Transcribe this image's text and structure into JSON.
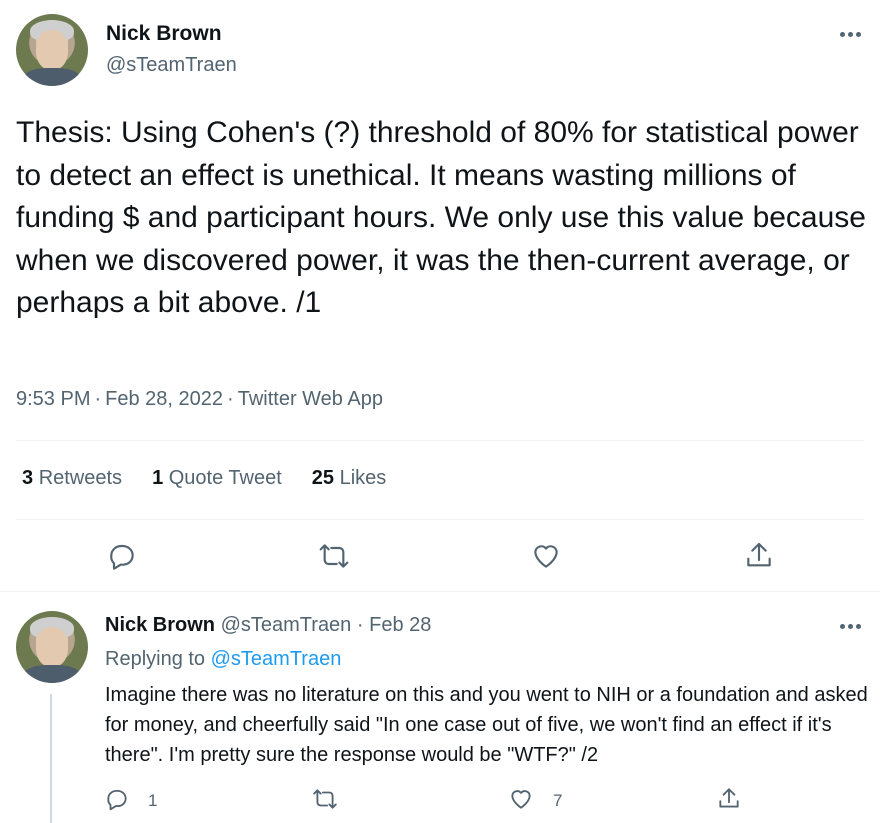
{
  "tweet": {
    "author_name": "Nick Brown",
    "author_handle": "@sTeamTraen",
    "text": "Thesis: Using Cohen's (?) threshold of 80% for statistical power to detect an effect is unethical. It means wasting millions of funding $ and participant hours. We only use this value because when we discovered power, it was the then-current average, or perhaps a bit above. /1",
    "time": "9:53 PM",
    "date": "Feb 28, 2022",
    "source": "Twitter Web App",
    "separator": "·",
    "stats": {
      "retweets_count": "3",
      "retweets_label": "Retweets",
      "quotes_count": "1",
      "quotes_label": "Quote Tweet",
      "likes_count": "25",
      "likes_label": "Likes"
    },
    "actions": [
      "reply-icon",
      "retweet-icon",
      "like-icon",
      "share-icon"
    ]
  },
  "reply": {
    "author_name": "Nick Brown",
    "author_handle": "@sTeamTraen",
    "separator": "·",
    "date": "Feb 28",
    "replying_label": "Replying to",
    "replying_to": "@sTeamTraen",
    "text": "Imagine there was no literature on this and you went to NIH or a foundation and asked for money, and cheerfully said \"In one case out of five, we won't find an effect if it's there\". I'm pretty sure the response would be \"WTF?\" /2",
    "reply_count": "1",
    "like_count": "7"
  },
  "colors": {
    "text": "#0f1419",
    "secondary": "#536471",
    "link": "#1d9bf0",
    "divider": "#eff3f4"
  }
}
